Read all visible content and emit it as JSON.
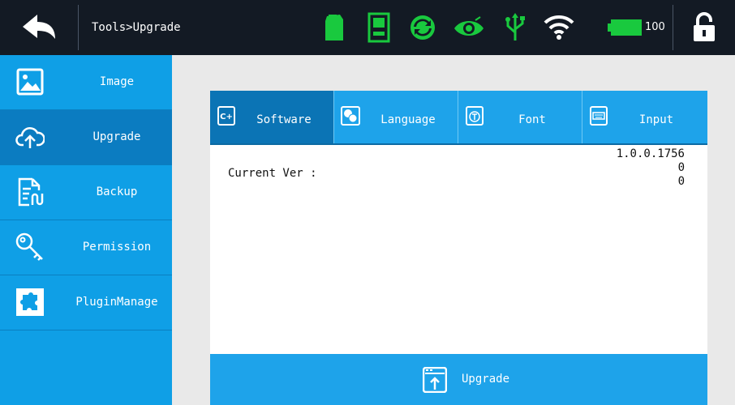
{
  "header": {
    "breadcrumb": "Tools>Upgrade",
    "battery_level": "100",
    "status_icons": [
      "ink-cartridge-icon",
      "printer-icon",
      "sync-icon",
      "eye-icon",
      "usb-icon",
      "wifi-icon",
      "battery-icon"
    ]
  },
  "sidebar": {
    "items": [
      {
        "label": "Image",
        "icon": "image-icon"
      },
      {
        "label": "Upgrade",
        "icon": "cloud-upload-icon",
        "active": true
      },
      {
        "label": "Backup",
        "icon": "backup-icon"
      },
      {
        "label": "Permission",
        "icon": "key-icon"
      },
      {
        "label": "PluginManage",
        "icon": "puzzle-icon"
      }
    ]
  },
  "tabs": [
    {
      "label": "Software",
      "icon": "c-plus-icon",
      "active": true
    },
    {
      "label": "Language",
      "icon": "language-icon"
    },
    {
      "label": "Font",
      "icon": "font-icon"
    },
    {
      "label": "Input",
      "icon": "keyboard-icon"
    }
  ],
  "content": {
    "current_label": "Current Ver :",
    "versions": [
      "1.0.0.1756",
      "0",
      "0"
    ]
  },
  "action": {
    "upgrade_label": "Upgrade"
  },
  "colors": {
    "topbar": "#131a24",
    "sidebar": "#0f9fe6",
    "sidebar_active": "#0b7cc1",
    "tab_bar": "#1ea3ea",
    "tab_active": "#0b74b5",
    "status_green": "#19c93e"
  }
}
